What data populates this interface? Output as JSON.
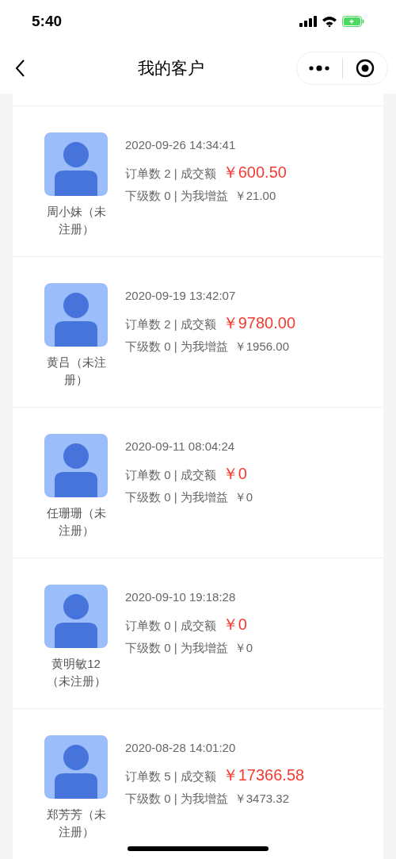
{
  "status_bar": {
    "time": "5:40"
  },
  "nav": {
    "title": "我的客户"
  },
  "customers": [
    {
      "name": "周小妹（未注册）",
      "date": "2020-09-26 14:34:41",
      "orders_label": "订单数 2 | 成交额",
      "amount": "￥600.50",
      "earnings_label": "下级数 0 | 为我增益",
      "earnings": "￥21.00"
    },
    {
      "name": "黄吕（未注册）",
      "date": "2020-09-19 13:42:07",
      "orders_label": "订单数 2 | 成交额",
      "amount": "￥9780.00",
      "earnings_label": "下级数 0 | 为我增益",
      "earnings": "￥1956.00"
    },
    {
      "name": "任珊珊（未注册）",
      "date": "2020-09-11 08:04:24",
      "orders_label": "订单数 0 | 成交额",
      "amount": "￥0",
      "earnings_label": "下级数 0 | 为我增益",
      "earnings": "￥0"
    },
    {
      "name": "黄明敏12（未注册）",
      "date": "2020-09-10 19:18:28",
      "orders_label": "订单数 0 | 成交额",
      "amount": "￥0",
      "earnings_label": "下级数 0 | 为我增益",
      "earnings": "￥0"
    },
    {
      "name": "郑芳芳（未注册）",
      "date": "2020-08-28 14:01:20",
      "orders_label": "订单数 5 | 成交额",
      "amount": "￥17366.58",
      "earnings_label": "下级数 0 | 为我增益",
      "earnings": "￥3473.32"
    }
  ]
}
